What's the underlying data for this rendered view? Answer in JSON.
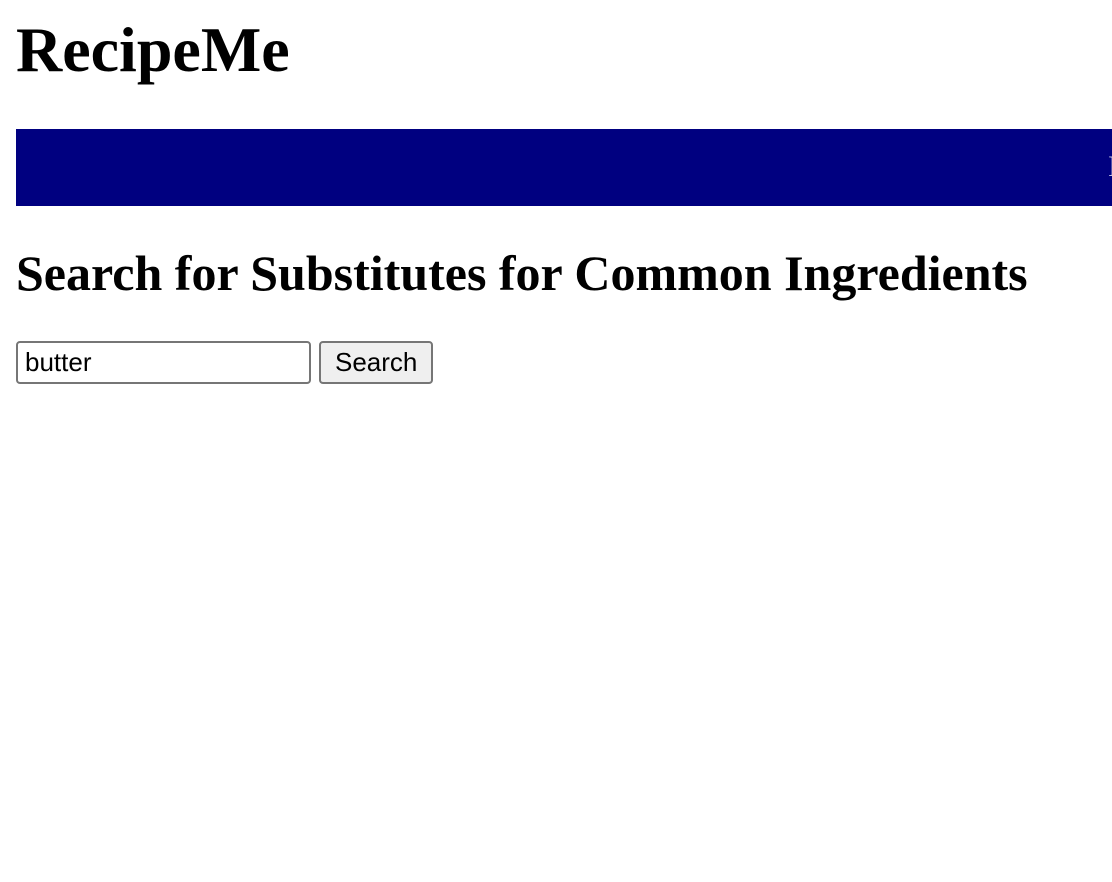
{
  "header": {
    "site_title": "RecipeMe"
  },
  "nav": {
    "background_color": "#000080",
    "clipped_text": "I"
  },
  "main": {
    "heading": "Search for Substitutes for Common Ingredients",
    "search": {
      "input_value": "butter",
      "button_label": "Search"
    }
  }
}
